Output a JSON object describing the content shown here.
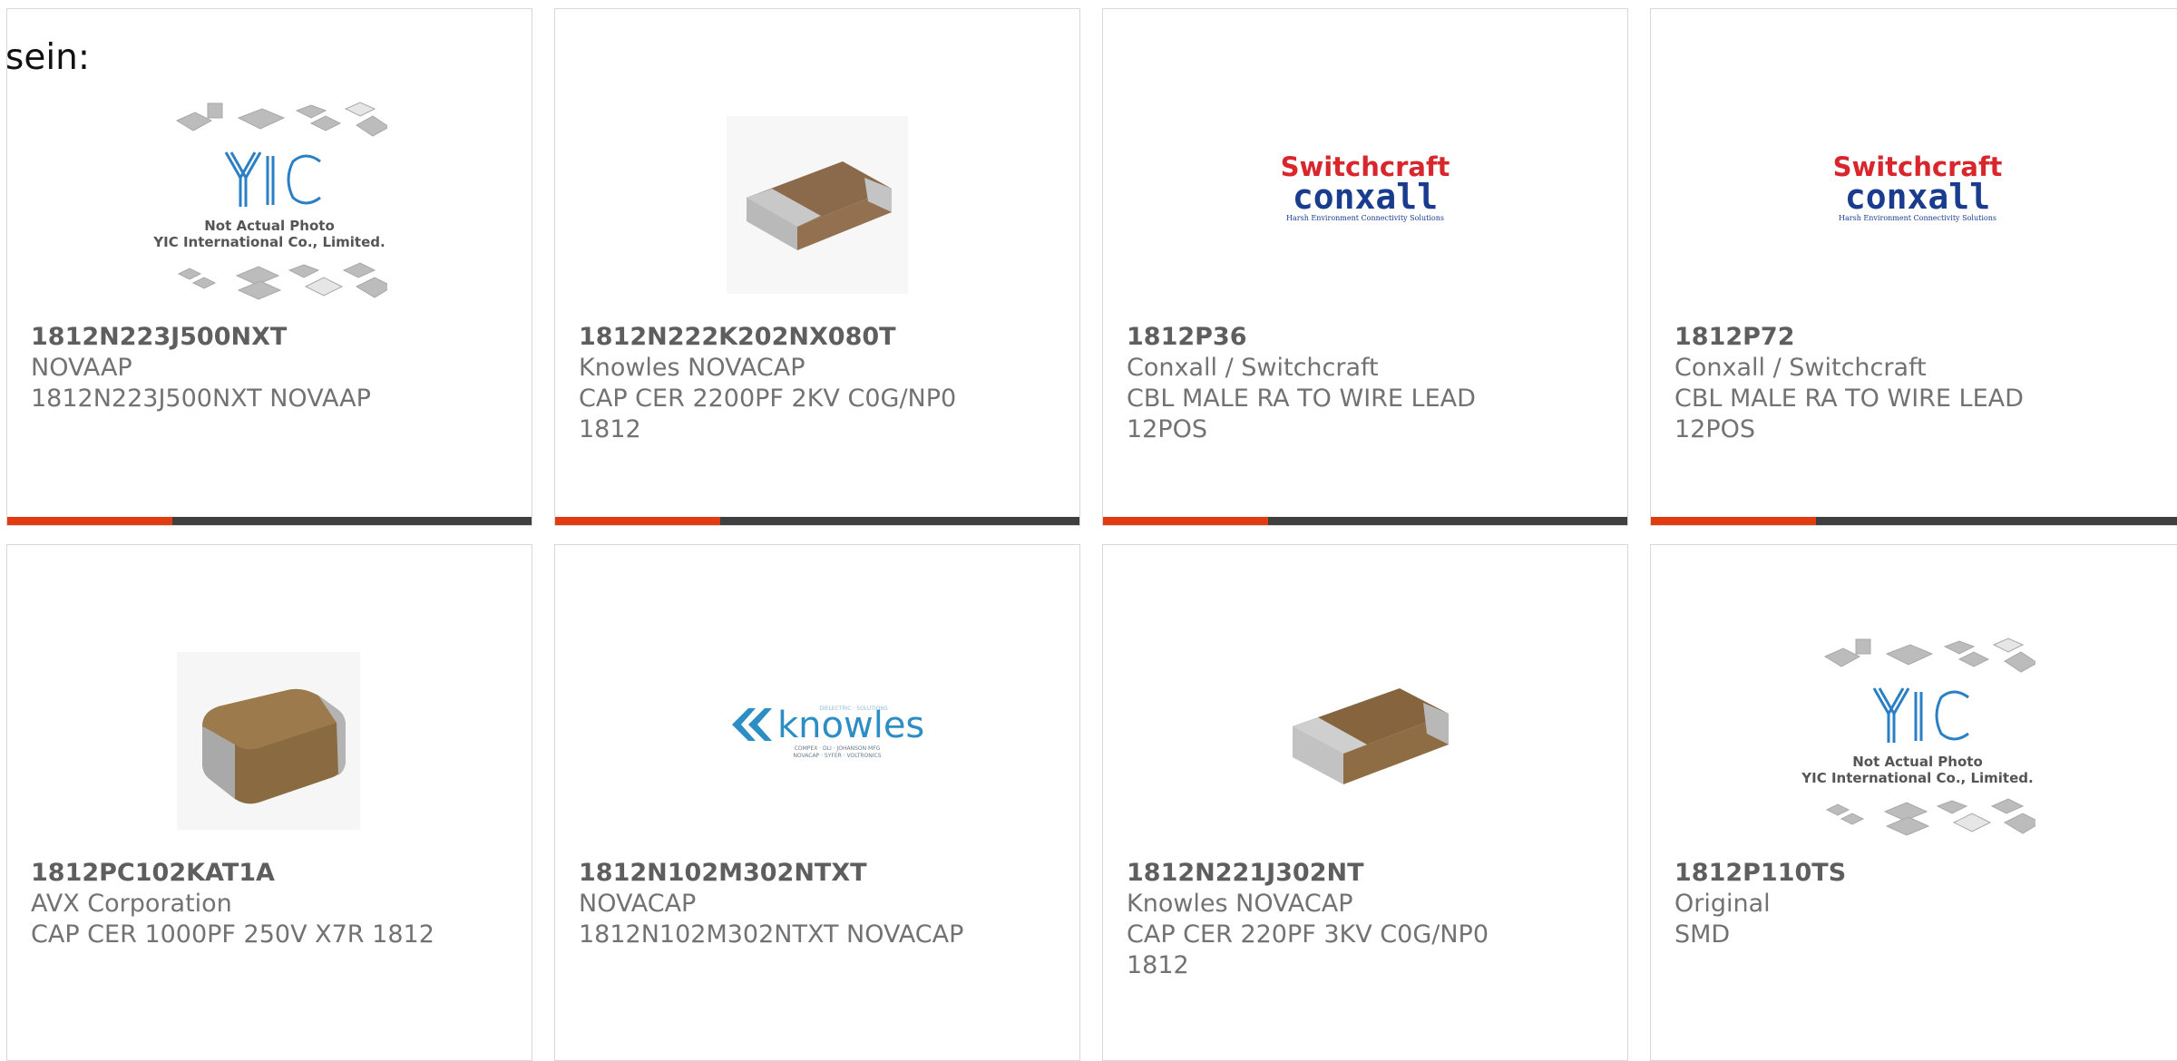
{
  "top_label": "sein:",
  "colors": {
    "accent": "#e33b10",
    "bar": "#3f3f3f",
    "switchcraft_red": "#d8262c",
    "conxall_blue": "#1a3c8f",
    "knowles_blue": "#2d8ec3"
  },
  "placeholder": {
    "line1": "Not Actual Photo",
    "line2": "YIC International Co., Limited.",
    "logo": "YIC"
  },
  "logos": {
    "switchcraft": "Switchcraft",
    "conxall": "conxall",
    "conxall_tagline": "Harsh Environment Connectivity Solutions",
    "knowles": "knowles",
    "knowles_tag1": "DIELECTRIC · SOLUTIONS",
    "knowles_tag2": "COMPEX · DLI · JOHANSON MFG",
    "knowles_tag3": "NOVACAP · SYFER · VOLTRONICS"
  },
  "products": [
    {
      "part": "1812N223J500NXT",
      "lines": [
        "NOVAAP",
        "1812N223J500NXT NOVAAP",
        ""
      ],
      "image": "placeholder"
    },
    {
      "part": "1812N222K202NX080T",
      "lines": [
        "Knowles NOVACAP",
        "CAP CER 2200PF 2KV C0G/NP0",
        "1812"
      ],
      "image": "chip-flat"
    },
    {
      "part": "1812P36",
      "lines": [
        "Conxall / Switchcraft",
        "CBL MALE RA TO WIRE LEAD",
        "12POS"
      ],
      "image": "switchcraft-logo"
    },
    {
      "part": "1812P72",
      "lines": [
        "Conxall / Switchcraft",
        "CBL MALE RA TO WIRE LEAD",
        "12POS"
      ],
      "image": "switchcraft-logo"
    },
    {
      "part": "1812PC102KAT1A",
      "lines": [
        "AVX Corporation",
        "CAP CER 1000PF 250V X7R 1812",
        ""
      ],
      "image": "chip-rounded"
    },
    {
      "part": "1812N102M302NTXT",
      "lines": [
        "NOVACAP",
        "1812N102M302NTXT NOVACAP",
        ""
      ],
      "image": "knowles-logo"
    },
    {
      "part": "1812N221J302NT",
      "lines": [
        "Knowles NOVACAP",
        "CAP CER 220PF 3KV C0G/NP0",
        "1812"
      ],
      "image": "chip-flat"
    },
    {
      "part": "1812P110TS",
      "lines": [
        "Original",
        "SMD",
        ""
      ],
      "image": "placeholder"
    }
  ]
}
